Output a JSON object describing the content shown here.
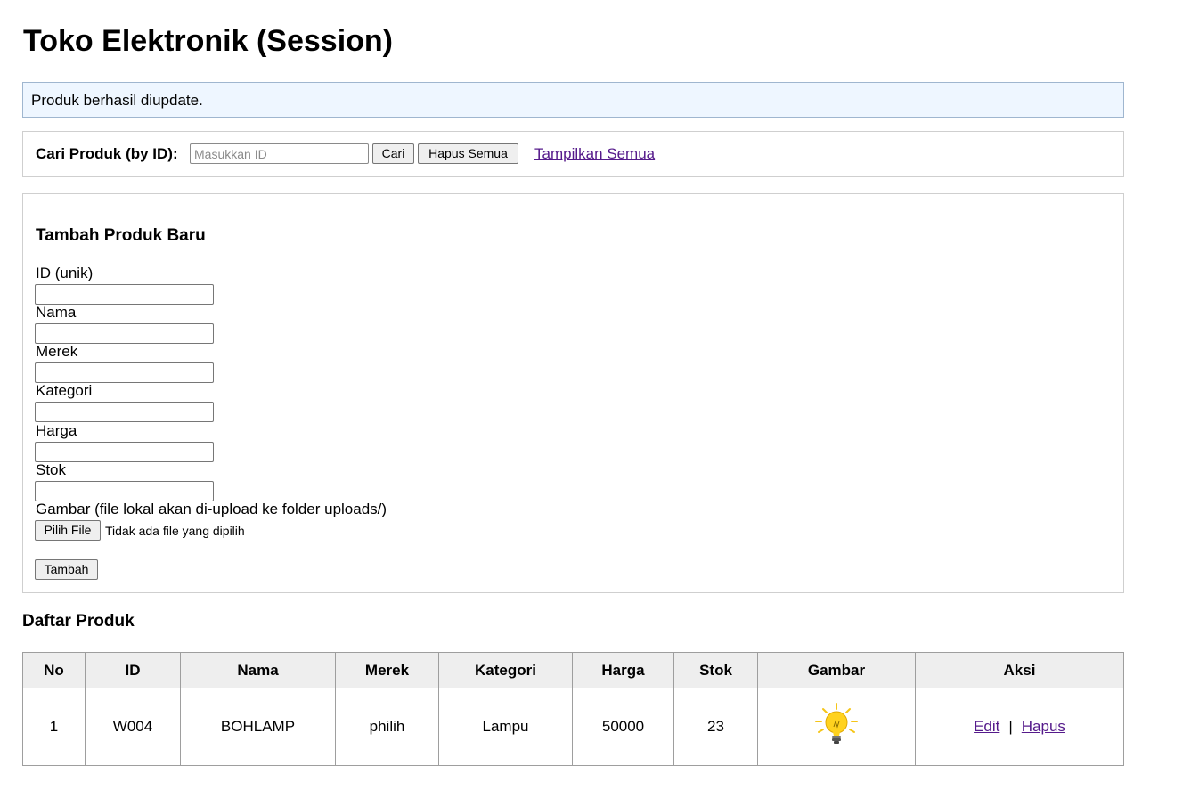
{
  "page": {
    "title": "Toko Elektronik (Session)",
    "alert": "Produk berhasil diupdate."
  },
  "search": {
    "label": "Cari Produk (by ID):",
    "placeholder": "Masukkan ID",
    "value": "",
    "search_button": "Cari",
    "delete_all_button": "Hapus Semua",
    "show_all_link": "Tampilkan Semua"
  },
  "form": {
    "title": "Tambah Produk Baru",
    "fields": [
      {
        "label": "ID (unik)",
        "value": ""
      },
      {
        "label": "Nama",
        "value": ""
      },
      {
        "label": "Merek",
        "value": ""
      },
      {
        "label": "Kategori",
        "value": ""
      },
      {
        "label": "Harga",
        "value": ""
      },
      {
        "label": "Stok",
        "value": ""
      }
    ],
    "image_label": "Gambar (file lokal akan di-upload ke folder uploads/)",
    "file_button": "Pilih File",
    "file_status": "Tidak ada file yang dipilih",
    "submit_button": "Tambah"
  },
  "list": {
    "title": "Daftar Produk",
    "columns": [
      "No",
      "ID",
      "Nama",
      "Merek",
      "Kategori",
      "Harga",
      "Stok",
      "Gambar",
      "Aksi"
    ],
    "rows": [
      {
        "no": "1",
        "id": "W004",
        "nama": "BOHLAMP",
        "merek": "philih",
        "kategori": "Lampu",
        "harga": "50000",
        "stok": "23",
        "gambar_icon": "lightbulb-icon",
        "edit": "Edit",
        "separator": "|",
        "hapus": "Hapus"
      }
    ]
  },
  "colors": {
    "alert_bg": "#eef6ff",
    "link": "#551a8b",
    "header_bg": "#eeeeee"
  }
}
